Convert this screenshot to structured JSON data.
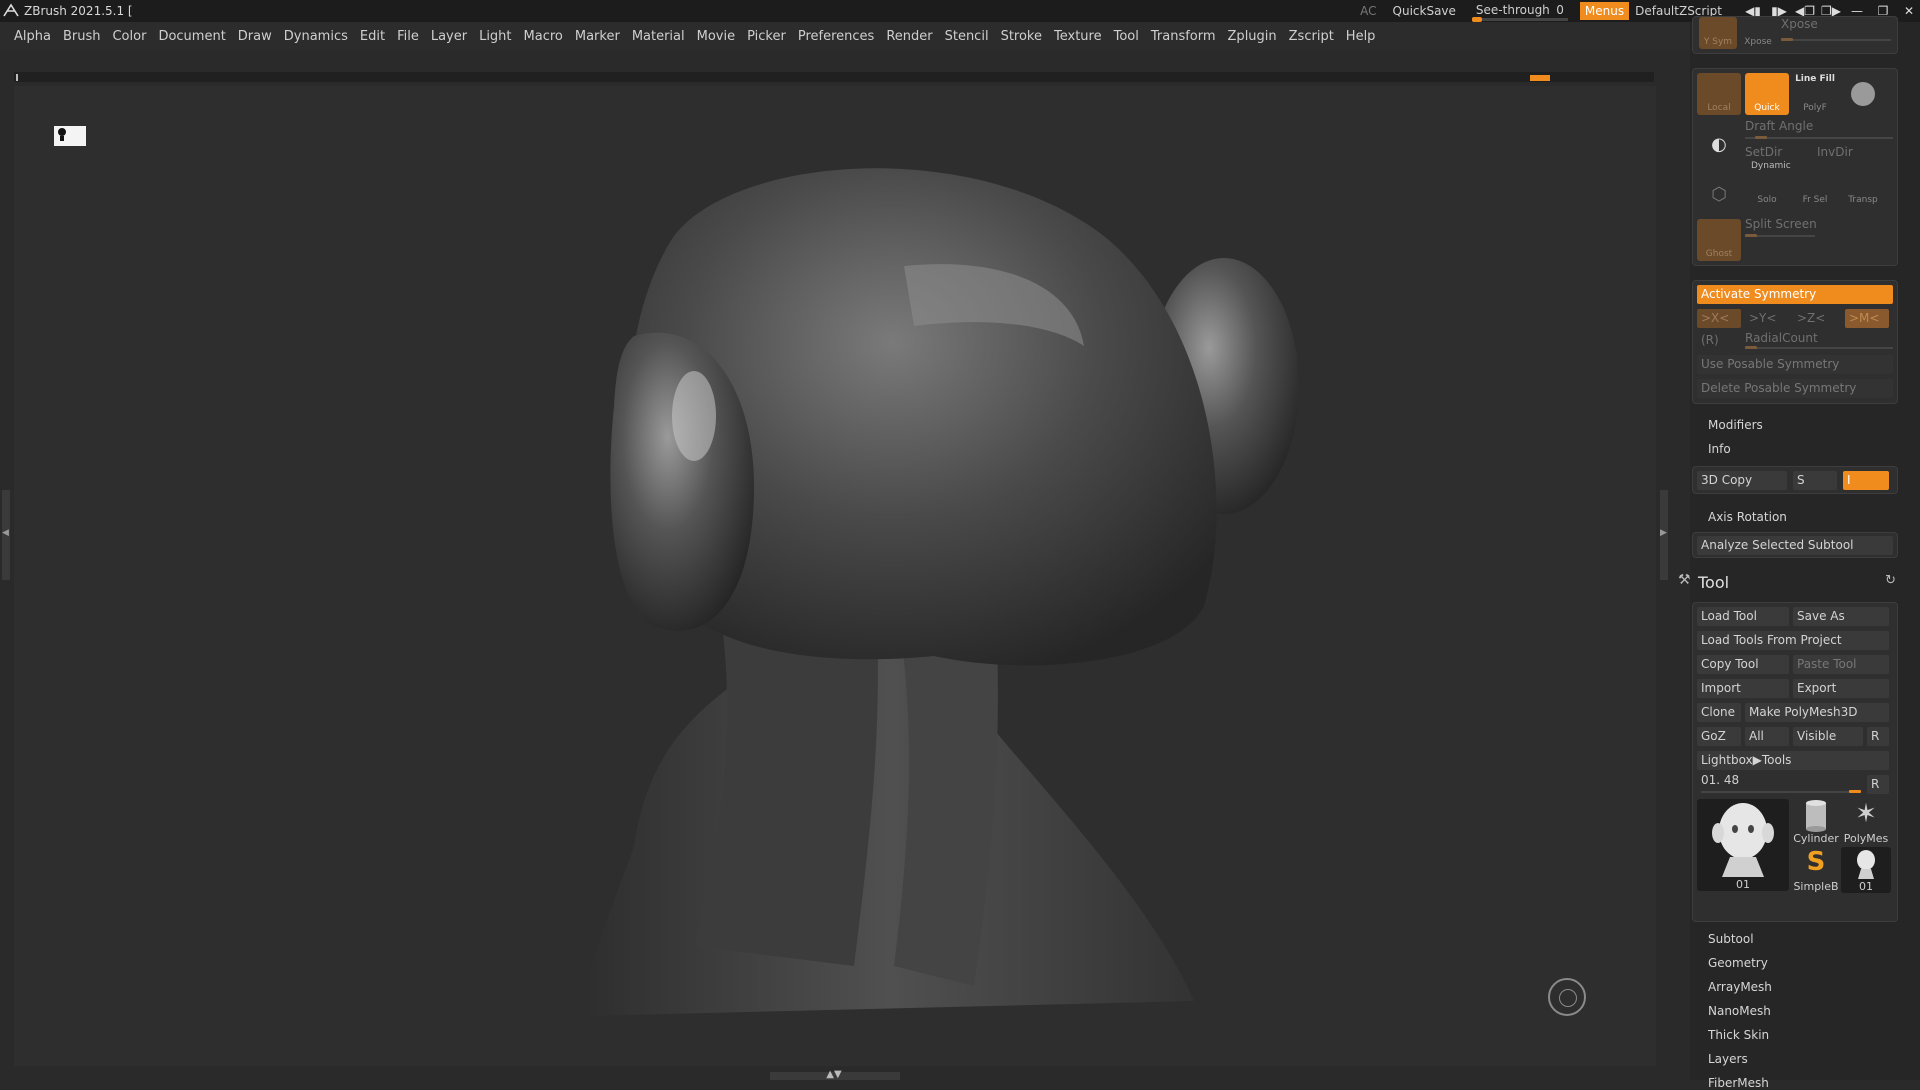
{
  "titlebar": {
    "app_title": "ZBrush 2021.5.1 [",
    "ac": "AC",
    "quicksave": "QuickSave",
    "see_through_label": "See-through",
    "see_through_value": "0",
    "menus": "Menus",
    "default_zscript": "DefaultZScript"
  },
  "menubar": [
    "Alpha",
    "Brush",
    "Color",
    "Document",
    "Draw",
    "Dynamics",
    "Edit",
    "File",
    "Layer",
    "Light",
    "Macro",
    "Marker",
    "Material",
    "Movie",
    "Picker",
    "Preferences",
    "Render",
    "Stencil",
    "Stroke",
    "Texture",
    "Tool",
    "Transform",
    "Zplugin",
    "Zscript",
    "Help"
  ],
  "panel": {
    "top_labels": {
      "ysym": "Y Sym",
      "xpose": "Xpose",
      "xpose_label": "Xpose"
    },
    "transp_group": {
      "local": "Local",
      "quick": "Quick",
      "line_fill": "Line Fill",
      "polyf": "PolyF",
      "draft_angle": "Draft Angle",
      "setdir": "SetDir",
      "invdir": "InvDir",
      "dynamic": "Dynamic",
      "solo": "Solo",
      "frsel": "Fr Sel",
      "transp": "Transp",
      "ghost": "Ghost",
      "split_screen": "Split Screen"
    },
    "symmetry": {
      "activate": "Activate Symmetry",
      "x": ">X<",
      "y": ">Y<",
      "z": ">Z<",
      "m": ">M<",
      "r": "(R)",
      "radial_count": "RadialCount",
      "use_posable": "Use Posable Symmetry",
      "delete_posable": "Delete Posable Symmetry"
    },
    "modifiers": "Modifiers",
    "info": "Info",
    "copy3d": {
      "label": "3D Copy",
      "s": "S",
      "i": "I"
    },
    "axis_rotation": "Axis Rotation",
    "analyze": "Analyze Selected Subtool",
    "tool": {
      "title": "Tool",
      "load_tool": "Load Tool",
      "save_as": "Save As",
      "load_from_project": "Load Tools From Project",
      "copy_tool": "Copy Tool",
      "paste_tool": "Paste Tool",
      "import": "Import",
      "export": "Export",
      "clone": "Clone",
      "make_polymesh": "Make PolyMesh3D",
      "goz": "GoZ",
      "all": "All",
      "visible": "Visible",
      "r": "R",
      "lightbox_tools": "Lightbox▶Tools",
      "current_tool": "01. 48",
      "thumbs": {
        "main": "01",
        "cylinder": "Cylinder",
        "polymesh": "PolyMes",
        "simpleb": "SimpleB",
        "small": "01"
      }
    },
    "sections": [
      "Subtool",
      "Geometry",
      "ArrayMesh",
      "NanoMesh",
      "Thick Skin",
      "Layers",
      "FiberMesh"
    ]
  },
  "colors": {
    "accent": "#f08c1e",
    "bg": "#2a2a2a",
    "panel": "#262626"
  }
}
